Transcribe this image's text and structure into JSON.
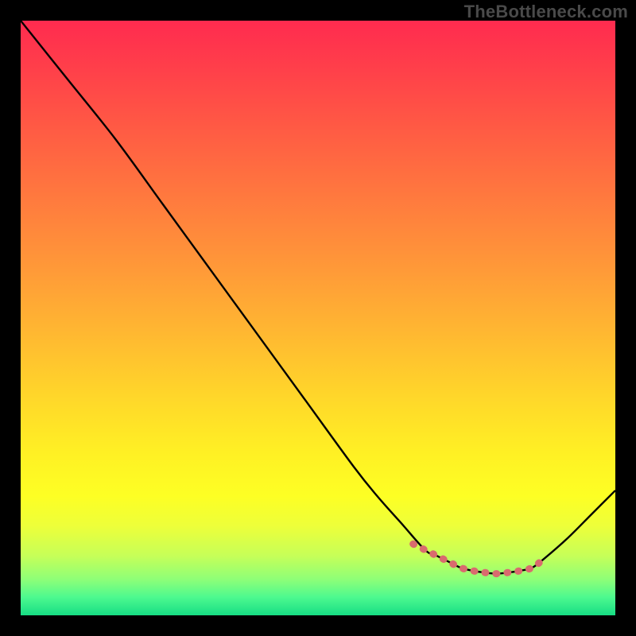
{
  "watermark": "TheBottleneck.com",
  "chart_data": {
    "type": "line",
    "title": "",
    "xlabel": "",
    "ylabel": "",
    "xlim": [
      0,
      100
    ],
    "ylim": [
      0,
      100
    ],
    "grid": false,
    "legend": false,
    "series": [
      {
        "name": "bottleneck-curve",
        "color": "#000000",
        "x": [
          0,
          8,
          16,
          24,
          32,
          40,
          48,
          56,
          60,
          64,
          68,
          70,
          72,
          74,
          76,
          78,
          80,
          82,
          84,
          86,
          88,
          92,
          96,
          100
        ],
        "values": [
          100,
          90,
          80,
          69,
          58,
          47,
          36,
          25,
          20,
          15.5,
          11,
          10,
          9,
          8,
          7.5,
          7.2,
          7,
          7.2,
          7.5,
          8,
          9.5,
          13,
          17,
          21
        ]
      },
      {
        "name": "highlight-band",
        "color": "#d96b6e",
        "x": [
          66,
          68,
          70,
          72,
          74,
          76,
          78,
          80,
          82,
          84,
          86,
          88
        ],
        "values": [
          12,
          11,
          10,
          9,
          8,
          7.5,
          7.2,
          7,
          7.2,
          7.5,
          8,
          9.5
        ]
      }
    ],
    "background": "rainbow-vertical-gradient"
  }
}
